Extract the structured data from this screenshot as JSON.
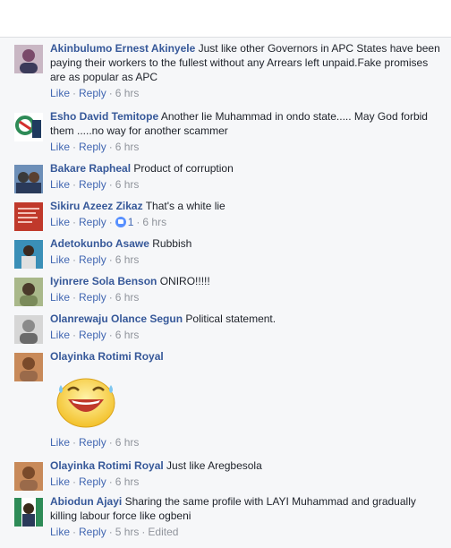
{
  "comments": [
    {
      "author": "Akinbulumo Ernest Akinyele",
      "text": "Just like other Governors in APC States have been paying their workers to the fullest without any Arrears left unpaid.Fake promises are as popular as APC",
      "like": "Like",
      "reply": "Reply",
      "time": "6 hrs",
      "avatar_color": "#7a4a6a"
    },
    {
      "author": "Esho David Temitope",
      "text": "Another lie Muhammad in ondo state..... May God forbid them .....no way for another scammer",
      "like": "Like",
      "reply": "Reply",
      "time": "6 hrs",
      "avatar_color": "#2e8b57"
    },
    {
      "author": "Bakare Rapheal",
      "text": "Product of corruption",
      "like": "Like",
      "reply": "Reply",
      "time": "6 hrs",
      "avatar_color": "#4a6fa5"
    },
    {
      "author": "Sikiru Azeez Zikaz",
      "text": "That's a white lie",
      "like": "Like",
      "reply": "Reply",
      "time": "6 hrs",
      "reactions": "1",
      "avatar_color": "#c0392b"
    },
    {
      "author": "Adetokunbo Asawe",
      "text": "Rubbish",
      "like": "Like",
      "reply": "Reply",
      "time": "6 hrs",
      "avatar_color": "#2c6e8f"
    },
    {
      "author": "Iyinrere Sola Benson",
      "text": "ONIRO!!!!!",
      "like": "Like",
      "reply": "Reply",
      "time": "6 hrs",
      "avatar_color": "#6b8e23"
    },
    {
      "author": "Olanrewaju Olance Segun",
      "text": "Political statement.",
      "like": "Like",
      "reply": "Reply",
      "time": "6 hrs",
      "avatar_color": "#9a9a9a"
    },
    {
      "author": "Olayinka Rotimi Royal",
      "text": "",
      "like": "Like",
      "reply": "Reply",
      "time": "6 hrs",
      "sticker": "laughing-face-sticker",
      "avatar_color": "#b5653a"
    },
    {
      "author": "Olayinka Rotimi Royal",
      "text": "Just like Aregbesola",
      "like": "Like",
      "reply": "Reply",
      "time": "6 hrs",
      "avatar_color": "#b5653a"
    },
    {
      "author": "Abiodun Ajayi",
      "text": "Sharing the same profile with LAYI Muhammad and gradually killing labour force like ogbeni",
      "like": "Like",
      "reply": "Reply",
      "time": "5 hrs",
      "edited": "Edited",
      "avatar_color": "#3a7d44"
    }
  ],
  "colors": {
    "link": "#4267b2",
    "name": "#365899",
    "meta": "#90949c",
    "background": "#f6f7f9"
  }
}
